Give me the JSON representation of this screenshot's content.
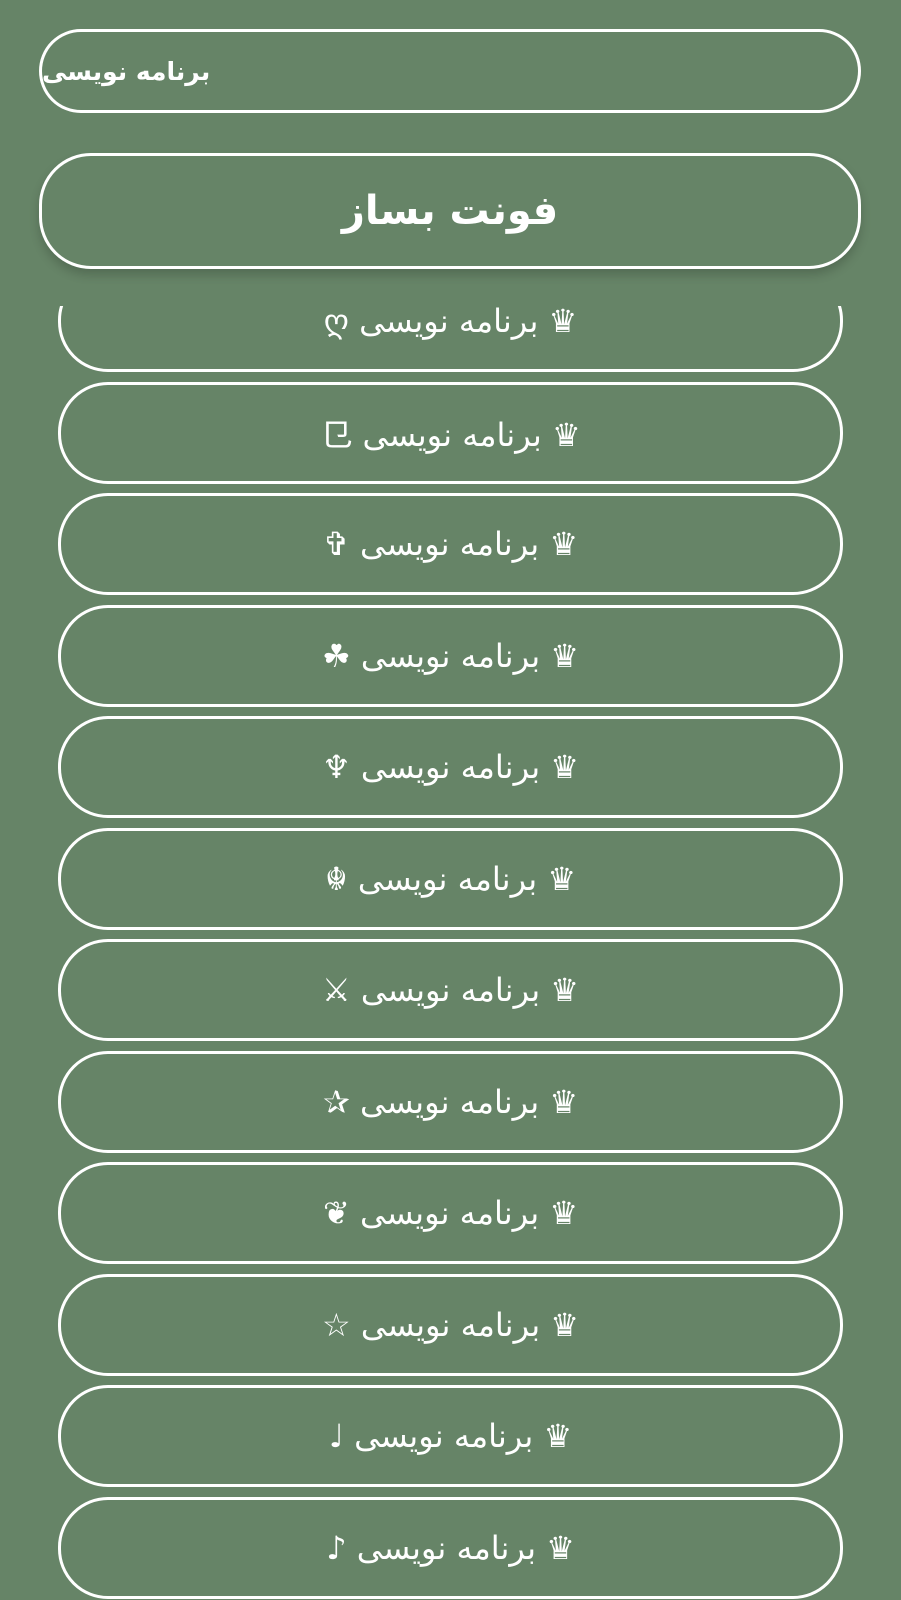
{
  "input": {
    "value": "برنامه نویسی"
  },
  "make_button": {
    "label": "فونت بساز"
  },
  "results": [
    "♛ برنامه نویسی ღ",
    "♛ برنامه نویسی ⺋",
    "♛ برنامه نویسی ✞",
    "♛ برنامه نویسی ☘",
    "♛ برنامه نویسی ♆",
    "♛ برنامه نویسی ☬",
    "♛ برنامه نویسی ⚔",
    "♛ برنامه نویسی ✰",
    "♛ برنامه نویسی ❦",
    "♛ برنامه نویسی ☆",
    "♛ برنامه نویسی ♩",
    "♛ برنامه نویسی ♪"
  ]
}
